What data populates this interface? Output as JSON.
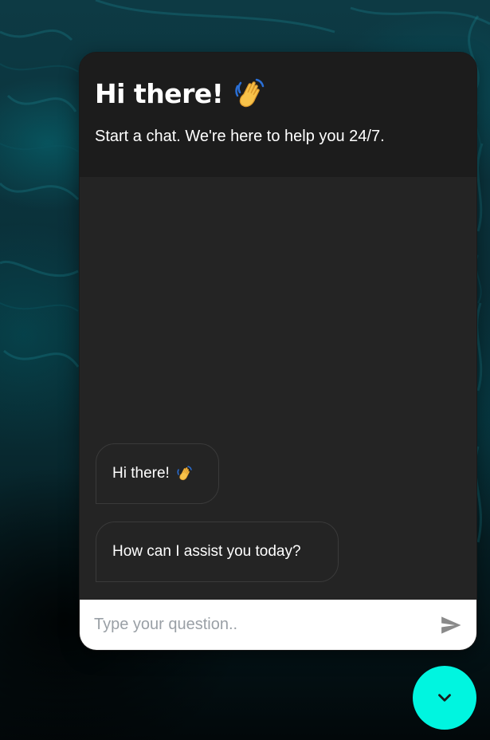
{
  "header": {
    "title": "Hi there!",
    "title_icon": "waving-hand-emoji",
    "subtitle": "Start a chat. We're here to help you 24/7."
  },
  "messages": [
    {
      "text": "Hi there!",
      "icon": "waving-hand-emoji"
    },
    {
      "text": "How can I assist you today?"
    }
  ],
  "input": {
    "placeholder": "Type your question..",
    "value": ""
  },
  "send_icon": "send-icon",
  "toggle_icon": "chevron-down-icon",
  "colors": {
    "header_bg": "#1c1c1c",
    "body_bg": "#242424",
    "accent": "#00f5e0",
    "text": "#ffffff"
  }
}
